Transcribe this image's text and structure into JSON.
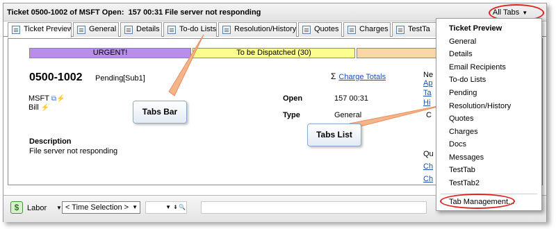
{
  "header": {
    "ticket_label": "Ticket 0500-1002 of MSFT Open:",
    "elapsed": "157 00:31",
    "summary": "File server not responding",
    "all_tabs_label": "All Tabs"
  },
  "tabs": [
    {
      "label": "Ticket Preview",
      "active": true
    },
    {
      "label": "General"
    },
    {
      "label": "Details"
    },
    {
      "label": "To-do Lists"
    },
    {
      "label": "Resolution/History"
    },
    {
      "label": "Quotes"
    },
    {
      "label": "Charges"
    },
    {
      "label": "TestTa"
    }
  ],
  "banners": {
    "urgent": "URGENT!",
    "dispatch": "To be Dispatched (30)"
  },
  "ticket": {
    "number": "0500-1002",
    "status": "Pending",
    "sub": "[Sub1]",
    "charge_totals": "Charge Totals",
    "customer": "MSFT",
    "contact": "Bill",
    "open_label": "Open",
    "open_value": "157 00:31",
    "type_label": "Type",
    "type_value": "General",
    "description_label": "Description",
    "description_value": "File server not responding",
    "right_clipped": {
      "ne": "Ne",
      "ap": "Ap",
      "ta": "Ta",
      "hi": "Hi",
      "c": "C",
      "qu": "Qu",
      "ch1": "Ch",
      "ch2": "Ch"
    }
  },
  "callouts": {
    "tabs_bar": "Tabs Bar",
    "tabs_list": "Tabs List"
  },
  "bottom": {
    "labor": "Labor",
    "time_selection": "< Time Selection >"
  },
  "menu": {
    "items": [
      "Ticket Preview",
      "General",
      "Details",
      "Email Recipients",
      "To-do Lists",
      "Pending",
      "Resolution/History",
      "Quotes",
      "Charges",
      "Docs",
      "Messages",
      "TestTab",
      "TestTab2"
    ],
    "management": "Tab Management..."
  },
  "colors": {
    "urgent": "#b98ee8",
    "dispatch": "#fdfd8f",
    "orange": "#fbd7a8",
    "callout_red": "#e02020"
  }
}
